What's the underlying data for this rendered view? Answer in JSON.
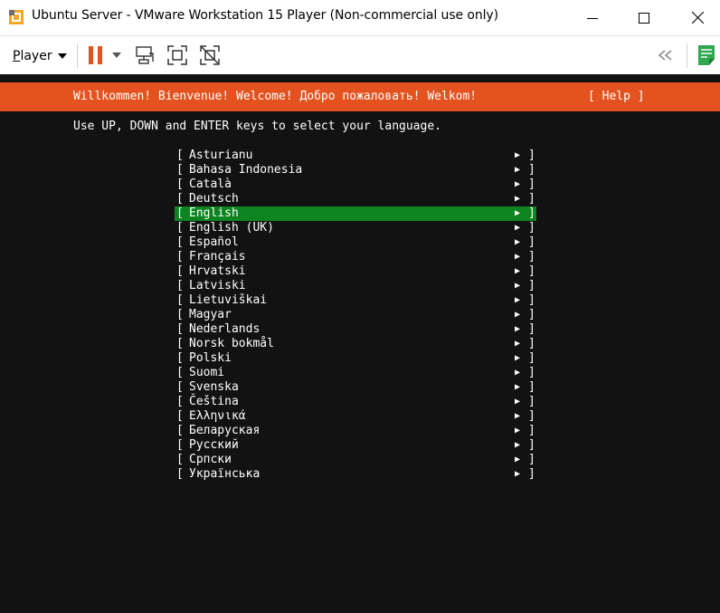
{
  "window": {
    "title": "Ubuntu Server - VMware Workstation 15 Player (Non-commercial use only)"
  },
  "toolbar": {
    "player_label": "Player",
    "accent_color": "#e4531f"
  },
  "console": {
    "banner_text": "Willkommen! Bienvenue! Welcome! Добро пожаловать! Welkom!",
    "help_label": "[ Help ]",
    "instruction": "Use UP, DOWN and ENTER keys to select your language.",
    "open_bracket": "[",
    "close_bracket": "]",
    "arrow": "▶",
    "selected_index": 4,
    "banner_color": "#e4531f",
    "selection_color": "#0e8420",
    "languages": [
      "Asturianu",
      "Bahasa Indonesia",
      "Català",
      "Deutsch",
      "English",
      "English (UK)",
      "Español",
      "Français",
      "Hrvatski",
      "Latviski",
      "Lietuviškai",
      "Magyar",
      "Nederlands",
      "Norsk bokmål",
      "Polski",
      "Suomi",
      "Svenska",
      "Čeština",
      "Ελληνικά",
      "Беларуская",
      "Русский",
      "Српски",
      "Українська"
    ]
  }
}
